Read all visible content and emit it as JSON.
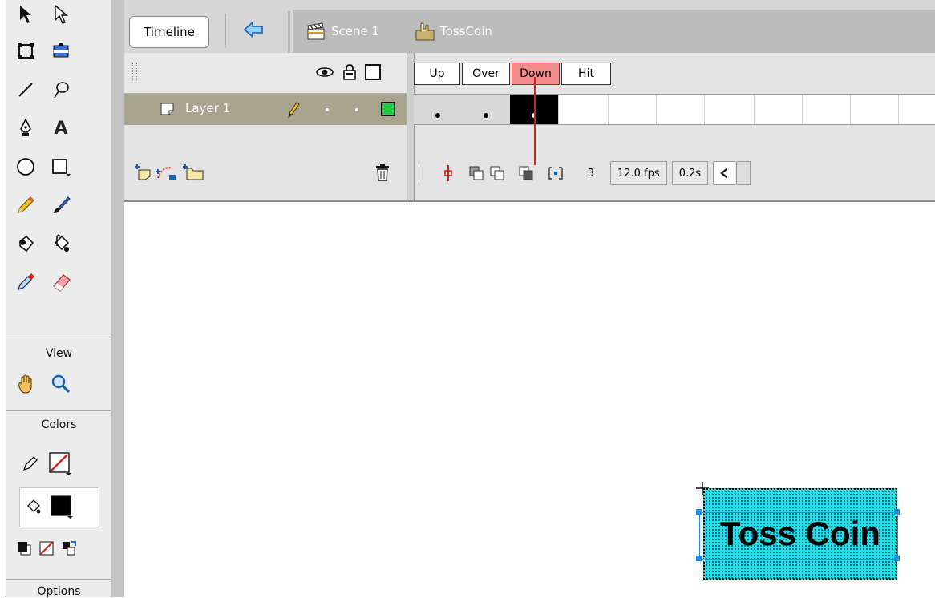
{
  "header": {
    "timeline_label": "Timeline",
    "breadcrumbs": [
      {
        "label": "Scene 1",
        "icon": "clapperboard-icon"
      },
      {
        "label": "TossCoin",
        "icon": "button-symbol-icon"
      }
    ]
  },
  "tools": {
    "sections": {
      "view": "View",
      "colors": "Colors",
      "options": "Options"
    }
  },
  "timeline": {
    "frame_labels": [
      "Up",
      "Over",
      "Down",
      "Hit"
    ],
    "selected_frame_label": "Down",
    "layer": {
      "name": "Layer 1",
      "outline_color": "#22cc44"
    },
    "current_frame": "3",
    "fps": "12.0 fps",
    "elapsed": "0.2s"
  },
  "stage": {
    "button_text": "Toss Coin",
    "button_fill": "#20e0ee"
  }
}
